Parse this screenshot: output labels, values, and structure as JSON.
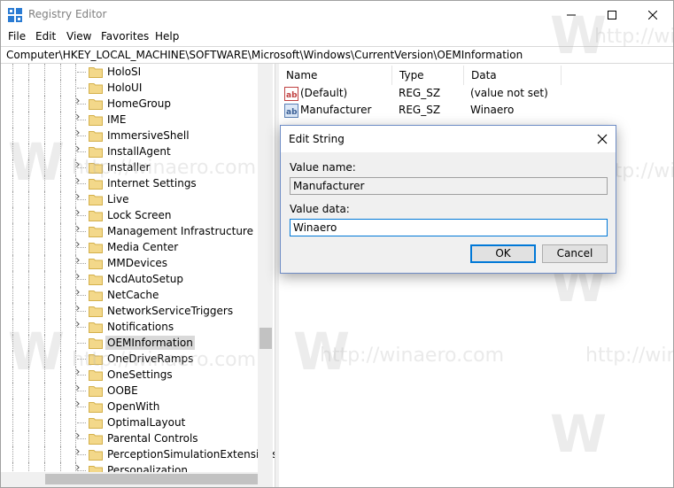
{
  "window": {
    "title": "Registry Editor",
    "icon": "registry-editor-icon"
  },
  "menu": {
    "items": [
      "File",
      "Edit",
      "View",
      "Favorites",
      "Help"
    ]
  },
  "address": {
    "path": "Computer\\HKEY_LOCAL_MACHINE\\SOFTWARE\\Microsoft\\Windows\\CurrentVersion\\OEMInformation"
  },
  "tree": {
    "items": [
      {
        "label": "HoloSI",
        "expandable": false
      },
      {
        "label": "HoloUI",
        "expandable": false
      },
      {
        "label": "HomeGroup",
        "expandable": true
      },
      {
        "label": "IME",
        "expandable": true
      },
      {
        "label": "ImmersiveShell",
        "expandable": true
      },
      {
        "label": "InstallAgent",
        "expandable": true
      },
      {
        "label": "Installer",
        "expandable": true
      },
      {
        "label": "Internet Settings",
        "expandable": true
      },
      {
        "label": "Live",
        "expandable": true
      },
      {
        "label": "Lock Screen",
        "expandable": true
      },
      {
        "label": "Management Infrastructure",
        "expandable": true
      },
      {
        "label": "Media Center",
        "expandable": true
      },
      {
        "label": "MMDevices",
        "expandable": true
      },
      {
        "label": "NcdAutoSetup",
        "expandable": true
      },
      {
        "label": "NetCache",
        "expandable": true
      },
      {
        "label": "NetworkServiceTriggers",
        "expandable": true
      },
      {
        "label": "Notifications",
        "expandable": true
      },
      {
        "label": "OEMInformation",
        "expandable": false,
        "selected": true
      },
      {
        "label": "OneDriveRamps",
        "expandable": false
      },
      {
        "label": "OneSettings",
        "expandable": true
      },
      {
        "label": "OOBE",
        "expandable": true
      },
      {
        "label": "OpenWith",
        "expandable": true
      },
      {
        "label": "OptimalLayout",
        "expandable": false
      },
      {
        "label": "Parental Controls",
        "expandable": true
      },
      {
        "label": "PerceptionSimulationExtensions",
        "expandable": true
      },
      {
        "label": "Personalization",
        "expandable": true
      }
    ]
  },
  "list": {
    "columns": [
      "Name",
      "Type",
      "Data"
    ],
    "rows": [
      {
        "name": "(Default)",
        "type": "REG_SZ",
        "data": "(value not set)",
        "icon": "string-value-icon"
      },
      {
        "name": "Manufacturer",
        "type": "REG_SZ",
        "data": "Winaero",
        "icon": "string-value-icon"
      }
    ]
  },
  "dialog": {
    "title": "Edit String",
    "value_name_label": "Value name:",
    "value_name": "Manufacturer",
    "value_data_label": "Value data:",
    "value_data": "Winaero",
    "ok_label": "OK",
    "cancel_label": "Cancel"
  },
  "watermark": {
    "text": "http://winaero.com",
    "letter": "W"
  },
  "colors": {
    "accent": "#0078d7",
    "folder": "#f3d88a",
    "selected_bg": "#d9d9d9"
  }
}
